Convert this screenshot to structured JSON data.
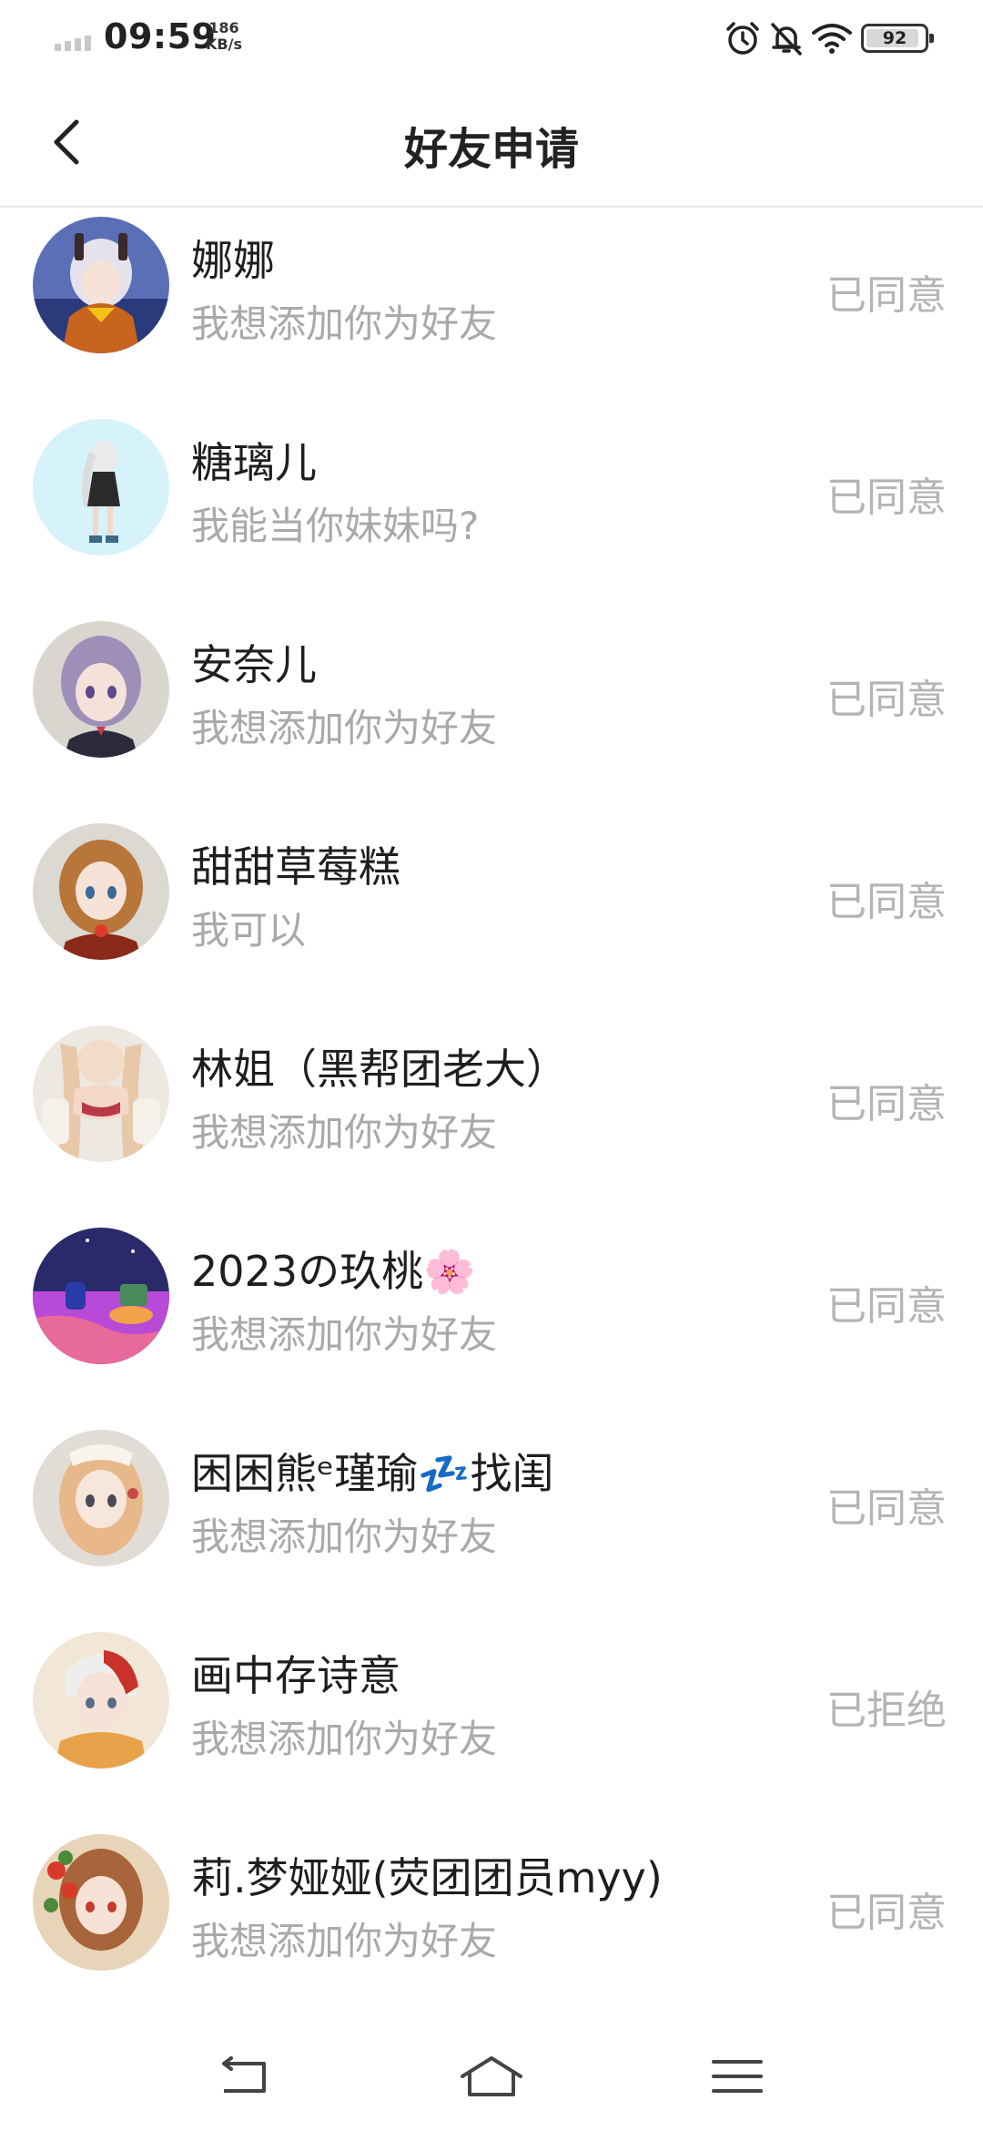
{
  "status_bar": {
    "time": "09:59",
    "speed_value": "186",
    "speed_unit": "KB/s",
    "battery": "92",
    "battery_level": 0.92
  },
  "header": {
    "title": "好友申请"
  },
  "requests": [
    {
      "name": "娜娜",
      "message": "我想添加你为好友",
      "status": "已同意"
    },
    {
      "name": "糖璃儿",
      "message": "我能当你妹妹吗?",
      "status": "已同意"
    },
    {
      "name": "安奈儿",
      "message": "我想添加你为好友",
      "status": "已同意"
    },
    {
      "name": "甜甜草莓糕",
      "message": "我可以",
      "status": "已同意"
    },
    {
      "name": "林姐（黑帮团老大）",
      "message": "我想添加你为好友",
      "status": "已同意"
    },
    {
      "name": "2023の玖桃🌸",
      "message": "我想添加你为好友",
      "status": "已同意"
    },
    {
      "name": "困困熊ᵉ瑾瑜💤找闺",
      "message": "我想添加你为好友",
      "status": "已同意"
    },
    {
      "name": "画中存诗意",
      "message": "我想添加你为好友",
      "status": "已拒绝"
    },
    {
      "name": "莉.梦娅娅(荧团团员myy)",
      "message": "我想添加你为好友",
      "status": "已同意"
    }
  ],
  "colors": {
    "status_text": "#b4b4b4",
    "message_text": "#a9a9a9",
    "divider": "#e8e8e8"
  }
}
